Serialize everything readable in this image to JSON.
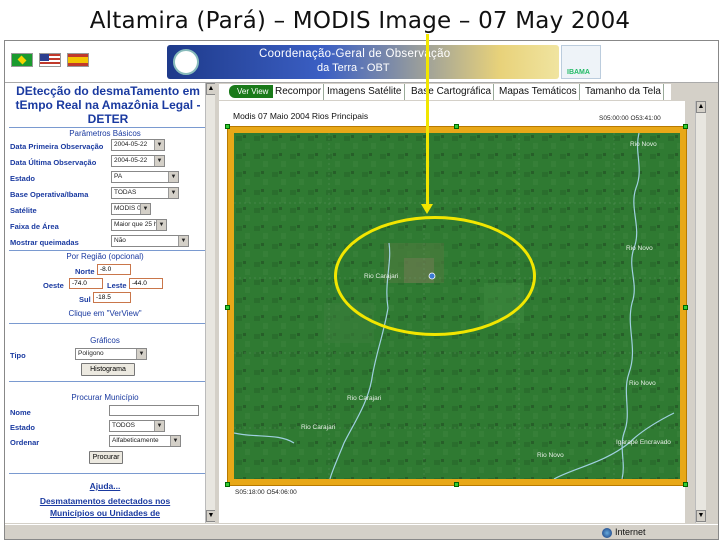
{
  "slide": {
    "title": "Altamira (Pará) – MODIS Image – 07 May 2004"
  },
  "banner": {
    "line1": "Coordenação-Geral de Observação",
    "line2": "da Terra - OBT",
    "ibama": "IBAMA"
  },
  "app": {
    "title": "DEtecção do desmaTamento em tEmpo Real na Amazônia Legal - DETER"
  },
  "params": {
    "section": "Parâmetros Básicos",
    "fields": [
      {
        "label": "Data Primeira Observação",
        "value": "2004-05-22"
      },
      {
        "label": "Data Última Observação",
        "value": "2004-05-22"
      },
      {
        "label": "Estado",
        "value": "PA"
      },
      {
        "label": "Base Operativa/Ibama",
        "value": "TODAS"
      },
      {
        "label": "Satélite",
        "value": "MODIS 07"
      },
      {
        "label": "Faixa de Área",
        "value": "Maior que 25 ha"
      },
      {
        "label": "Mostrar queimadas",
        "value": "Não"
      }
    ]
  },
  "region": {
    "section": "Por Região (opcional)",
    "norte_label": "Norte",
    "norte_value": "-8.0",
    "oeste_label": "Oeste",
    "oeste_value": "-74.0",
    "leste_label": "Leste",
    "leste_value": "-44.0",
    "sul_label": "Sul",
    "sul_value": "-18.5",
    "hint": "Clique em \"VerView\""
  },
  "graphs": {
    "section": "Gráficos",
    "tipo_label": "Tipo",
    "tipo_value": "Polígono",
    "button": "Histograma"
  },
  "municipio": {
    "section": "Procurar Município",
    "nome_label": "Nome",
    "nome_value": "",
    "estado_label": "Estado",
    "estado_value": "TODOS",
    "ordenar_label": "Ordenar",
    "ordenar_value": "Alfabeticamente",
    "button": "Procurar"
  },
  "help": {
    "ajuda": "Ajuda...",
    "desmat_line1": "Desmatamentos detectados nos",
    "desmat_line2": "Municípios ou Unidades de"
  },
  "tabs": [
    "Ver View",
    "Recompor",
    "Imagens Satélite",
    "Base Cartográfica",
    "Mapas Temáticos",
    "Tamanho da Tela"
  ],
  "map": {
    "title": "Modis 07 Maio 2004 Rios Principais",
    "coord_top": "S05:00:00 O53:41:00",
    "coord_bottom": "S05:18:00 O54:06:00",
    "rivers": [
      "Rio Novo",
      "Rio Novo",
      "Rio Carajari",
      "Rio Carajari",
      "Rio Carajari",
      "Rio Novo",
      "Rio Novo",
      "Igarapé Encravado"
    ]
  },
  "status": {
    "zone": "Internet"
  },
  "colors": {
    "annotation": "#f2e600",
    "map_forest": "#2f7a32",
    "frame": "#e8a818",
    "link_blue": "#1a3aa0"
  }
}
